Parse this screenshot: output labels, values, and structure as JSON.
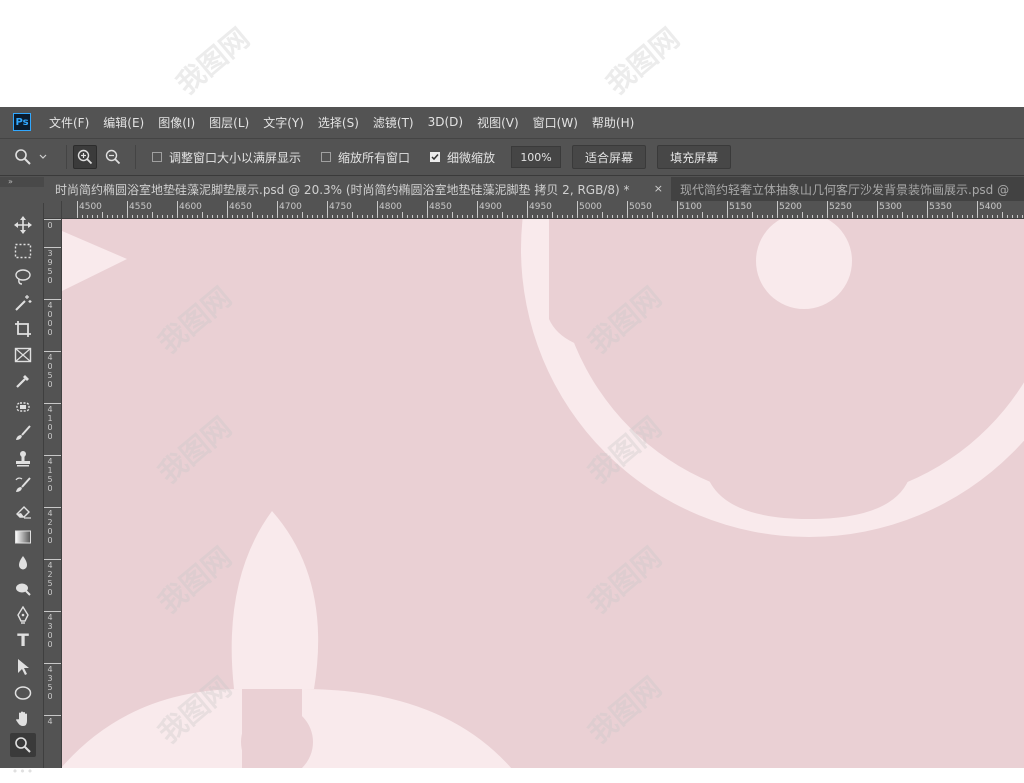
{
  "app": {
    "logo": "Ps"
  },
  "menu": [
    "文件(F)",
    "编辑(E)",
    "图像(I)",
    "图层(L)",
    "文字(Y)",
    "选择(S)",
    "滤镜(T)",
    "3D(D)",
    "视图(V)",
    "窗口(W)",
    "帮助(H)"
  ],
  "options": {
    "resize_windows": {
      "label": "调整窗口大小以满屏显示",
      "checked": false
    },
    "zoom_all": {
      "label": "缩放所有窗口",
      "checked": false
    },
    "scrubby_zoom": {
      "label": "细微缩放",
      "checked": true
    },
    "zoom_value": "100%",
    "fit_screen": "适合屏幕",
    "fill_screen": "填充屏幕"
  },
  "tabs": {
    "active": "时尚简约椭圆浴室地垫硅藻泥脚垫展示.psd @ 20.3% (时尚简约椭圆浴室地垫硅藻泥脚垫 拷贝 2, RGB/8) *",
    "close": "×",
    "inactive": "现代简约轻奢立体抽象山几何客厅沙发背景装饰画展示.psd @"
  },
  "collapse_glyph": "»",
  "ruler_h": [
    "4500",
    "4550",
    "4600",
    "4650",
    "4700",
    "4750",
    "4800",
    "4850",
    "4900",
    "4950",
    "5000",
    "5050",
    "5100",
    "5150",
    "5200",
    "5250",
    "5300",
    "5350",
    "5400"
  ],
  "ruler_v": [
    "0",
    "3950",
    "4000",
    "4050",
    "4100",
    "4150",
    "4200",
    "4250",
    "4300",
    "4350",
    "4"
  ],
  "watermark": "我图网",
  "colors": {
    "canvas_bg": "#ead0d4",
    "shape_light": "#f9eaec",
    "ui_bg": "#535353"
  },
  "tools": [
    "move-icon",
    "marquee-icon",
    "lasso-icon",
    "magic-wand-icon",
    "crop-icon",
    "frame-icon",
    "eyedropper-icon",
    "spot-heal-icon",
    "brush-icon",
    "stamp-icon",
    "history-brush-icon",
    "eraser-icon",
    "gradient-icon",
    "blur-icon",
    "dodge-icon",
    "pen-icon",
    "type-icon",
    "path-select-icon",
    "ellipse-icon",
    "hand-icon",
    "zoom-icon",
    "more-icon"
  ],
  "more_glyph": "•••",
  "type_glyph": "T"
}
